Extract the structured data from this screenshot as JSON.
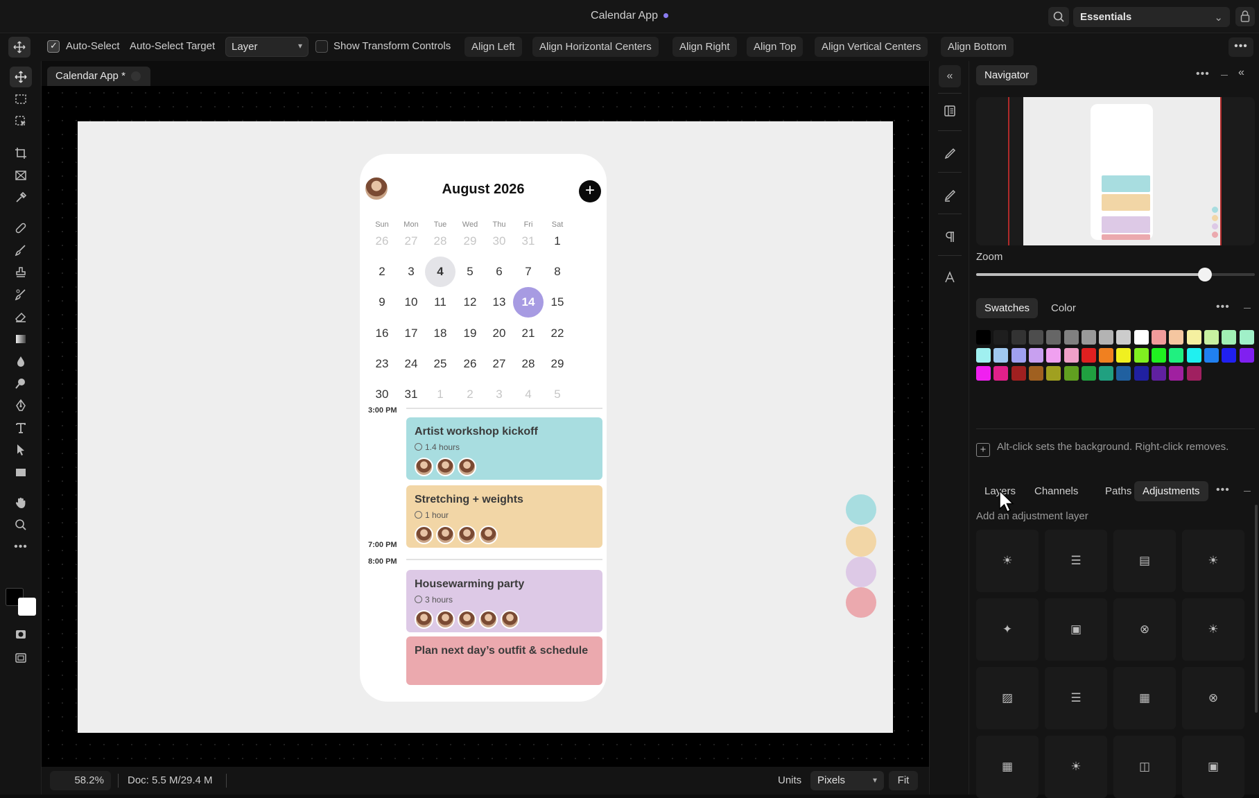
{
  "window": {
    "title": "Calendar App",
    "workspace": "Essentials"
  },
  "options": {
    "auto_select": "Auto-Select",
    "auto_select_target": "Auto-Select Target",
    "target_value": "Layer",
    "show_transform": "Show Transform Controls",
    "align": [
      "Align Left",
      "Align Horizontal Centers",
      "Align Right",
      "Align Top",
      "Align Vertical Centers",
      "Align Bottom"
    ],
    "more": "•••"
  },
  "doc": {
    "tab_label": "Calendar App *"
  },
  "calendar": {
    "title": "August 2026",
    "add": "+",
    "weekdays": [
      "Sun",
      "Mon",
      "Tue",
      "Wed",
      "Thu",
      "Fri",
      "Sat"
    ],
    "weeks": [
      [
        "26",
        "27",
        "28",
        "29",
        "30",
        "31",
        "1"
      ],
      [
        "2",
        "3",
        "4",
        "5",
        "6",
        "7",
        "8"
      ],
      [
        "9",
        "10",
        "11",
        "12",
        "13",
        "14",
        "15"
      ],
      [
        "16",
        "17",
        "18",
        "19",
        "20",
        "21",
        "22"
      ],
      [
        "23",
        "24",
        "25",
        "26",
        "27",
        "28",
        "29"
      ],
      [
        "30",
        "31",
        "1",
        "2",
        "3",
        "4",
        "5"
      ]
    ],
    "selected_day": "4",
    "today": "14",
    "times": [
      "3:00 PM",
      "7:00 PM",
      "8:00 PM"
    ],
    "events": [
      {
        "title": "Artist workshop kickoff",
        "duration": "1.4 hours",
        "attendees": 3,
        "color": "#a8dde0"
      },
      {
        "title": "Stretching + weights",
        "duration": "1 hour",
        "attendees": 4,
        "color": "#f2d6a6"
      },
      {
        "title": "Housewarming party",
        "duration": "3 hours",
        "attendees": 5,
        "color": "#ddc9e6"
      },
      {
        "title": "Plan next day’s outfit & schedule",
        "duration": "",
        "attendees": 0,
        "color": "#eba9ae"
      }
    ],
    "palette": [
      "#a8dde0",
      "#f2d6a6",
      "#ddc9e6",
      "#eba9ae"
    ]
  },
  "status": {
    "zoom": "58.2%",
    "doc": "Doc: 5.5 M/29.4 M",
    "units_label": "Units",
    "units": "Pixels",
    "fit": "Fit"
  },
  "strip": {
    "collapse": "«"
  },
  "navigator": {
    "tab": "Navigator",
    "zoom_label": "Zoom",
    "zoom_fraction": 0.82,
    "more": "•••",
    "collapse": "«"
  },
  "swatches": {
    "tabs": [
      "Swatches",
      "Color"
    ],
    "more": "•••",
    "colors": [
      "#000000",
      "#1e1e1e",
      "#333333",
      "#4d4d4d",
      "#666666",
      "#808080",
      "#999999",
      "#b3b3b3",
      "#cccccc",
      "#ffffff",
      "#f29b9b",
      "#f5c6a0",
      "#f5f0a0",
      "#c8f0a0",
      "#a0f0b4",
      "#a0f0c8",
      "#a0f0f0",
      "#a0c8f0",
      "#a0a0f0",
      "#c8a0f0",
      "#f0a0f0",
      "#f0a0c8",
      "#e02020",
      "#f08020",
      "#f0f020",
      "#80f020",
      "#20f020",
      "#20f080",
      "#20f0f0",
      "#2080f0",
      "#2020f0",
      "#8020f0",
      "#f020f0",
      "#e0208a",
      "#a02020",
      "#a06020",
      "#a0a020",
      "#60a020",
      "#20a040",
      "#20a080",
      "#2060a0",
      "#2020a0",
      "#6020a0",
      "#a020a0",
      "#a02060"
    ],
    "hint": "Alt-click sets the background. Right-click removes."
  },
  "adjustments": {
    "tabs": [
      "Layers",
      "Channels",
      "Paths",
      "Adjustments"
    ],
    "more": "•••",
    "add_label": "Add an adjustment layer",
    "buttons": [
      "brightness-icon",
      "sliders-icon",
      "curves-icon",
      "exposure-icon",
      "vibrance-icon",
      "photo-filter-icon",
      "invert-icon",
      "exposure-icon",
      "image-icon",
      "sliders-icon",
      "grid-icon",
      "invert-icon",
      "grid-icon",
      "brightness-icon",
      "channel-mixer-icon",
      "photo-filter-icon"
    ],
    "glyphs": [
      "☀",
      "☰",
      "▤",
      "☀",
      "✦",
      "▣",
      "⊗",
      "☀",
      "▨",
      "☰",
      "▦",
      "⊗",
      "▦",
      "☀",
      "◫",
      "▣"
    ]
  }
}
